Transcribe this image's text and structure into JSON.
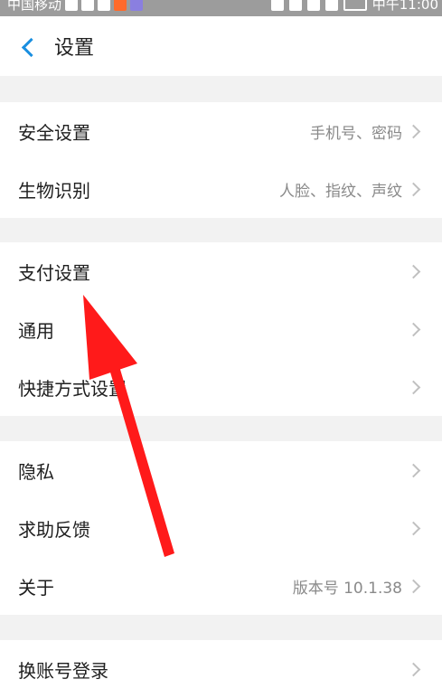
{
  "status_bar": {
    "carrier": "中国移动",
    "time": "中午11:00"
  },
  "header": {
    "title": "设置",
    "back_icon": "chevron-left-icon"
  },
  "groups": [
    {
      "items": [
        {
          "label": "安全设置",
          "value": "手机号、密码"
        },
        {
          "label": "生物识别",
          "value": "人脸、指纹、声纹"
        }
      ]
    },
    {
      "items": [
        {
          "label": "支付设置",
          "value": ""
        },
        {
          "label": "通用",
          "value": ""
        },
        {
          "label": "快捷方式设置",
          "value": ""
        }
      ]
    },
    {
      "items": [
        {
          "label": "隐私",
          "value": ""
        },
        {
          "label": "求助反馈",
          "value": ""
        },
        {
          "label": "关于",
          "value": "版本号 10.1.38"
        }
      ]
    },
    {
      "items": [
        {
          "label": "换账号登录",
          "value": ""
        }
      ]
    }
  ],
  "annotation": {
    "arrow_color": "#ff1a1a",
    "target": "支付设置"
  },
  "colors": {
    "accent": "#1a8fe0",
    "background": "#f2f2f2"
  }
}
